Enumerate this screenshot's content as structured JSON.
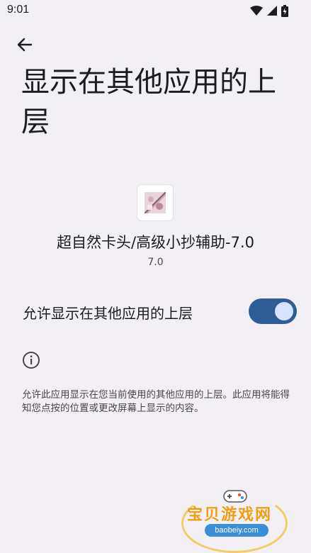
{
  "status_bar": {
    "time": "9:01",
    "icons": [
      "wifi-icon",
      "signal-icon",
      "battery-icon"
    ]
  },
  "header": {
    "back_icon": "arrow-back-icon",
    "title": "显示在其他应用的上层"
  },
  "app": {
    "name": "超自然卡头/高级小抄辅助-7.0",
    "version": "7.0"
  },
  "permission": {
    "label": "允许显示在其他应用的上层",
    "enabled": true,
    "accent_color": "#2f5e96"
  },
  "info": {
    "icon": "info-icon",
    "description": "允许此应用显示在您当前使用的其他应用的上层。此应用将能得知您点按的位置或更改屏幕上显示的内容。"
  },
  "watermark": {
    "title": "宝贝游戏网",
    "url": "baobeiy.com"
  }
}
